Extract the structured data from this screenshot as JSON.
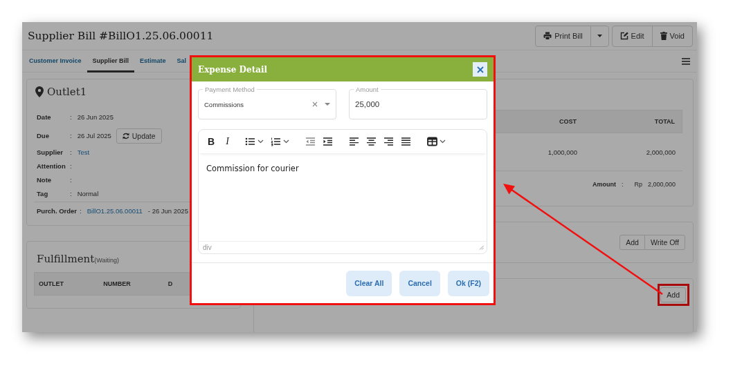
{
  "header": {
    "title": "Supplier Bill #BillO1.25.06.00011",
    "print_button": "Print Bill",
    "edit_button": "Edit",
    "void_button": "Void"
  },
  "tabs": [
    {
      "label": "Customer Invoice",
      "selected": false
    },
    {
      "label": "Supplier Bill",
      "selected": true
    },
    {
      "label": "Estimate",
      "selected": false
    },
    {
      "label": "Sal",
      "selected": false
    }
  ],
  "outlet_card": {
    "title": "Outlet1",
    "fields": [
      {
        "label": "Date",
        "colon": ":",
        "value": "26 Jun 2025"
      },
      {
        "label": "Due",
        "colon": ":",
        "value": "26 Jul 2025",
        "action": "Update"
      },
      {
        "label": "Supplier",
        "colon": ":",
        "value": "Test",
        "kind": "link"
      },
      {
        "label": "Attention",
        "colon": ":"
      },
      {
        "label": "Note",
        "colon": ":"
      },
      {
        "label": "Tag",
        "colon": ":",
        "value": "Normal"
      },
      {
        "label": "Purch. Order",
        "colon": ":",
        "value": "BillO1.25.06.00011",
        "kind": "link",
        "suffix": "- 26 Jun 2025",
        "divider": true
      }
    ]
  },
  "fulfillment": {
    "title": "Fulfillment",
    "status": "(Waiting)",
    "columns": [
      "OUTLET",
      "NUMBER",
      "D"
    ]
  },
  "items_table": {
    "columns": [
      "COST",
      "TOTAL"
    ],
    "rows": [
      [
        "1,000,000",
        "2,000,000"
      ]
    ],
    "amount_label": "Amount",
    "separator": ":",
    "currency": "Rp",
    "amount": "2,000,000"
  },
  "payments_card": {
    "buttons": [
      "Add",
      "Write Off"
    ]
  },
  "expenses_card": {
    "button": "Add",
    "highlighted": true
  },
  "callout_arrow": true,
  "dialog": {
    "title": "Expense Detail",
    "payment_method": {
      "label": "Payment Method",
      "value": "Commissions"
    },
    "amount": {
      "label": "Amount",
      "value": "25,000"
    },
    "toolbar": [
      {
        "kind": "bold",
        "label": "B"
      },
      {
        "kind": "italic",
        "label": "I"
      },
      {
        "kind": "bullet-list",
        "menu": true
      },
      {
        "kind": "numbered-list",
        "menu": true
      },
      {
        "kind": "outdent"
      },
      {
        "kind": "indent"
      },
      {
        "kind": "align-left"
      },
      {
        "kind": "align-center"
      },
      {
        "kind": "align-right"
      },
      {
        "kind": "justify"
      },
      {
        "kind": "table",
        "menu": true
      }
    ],
    "content": "Commission for courier",
    "status_path": "div",
    "buttons": [
      "Clear All",
      "Cancel",
      "Ok (F2)"
    ]
  }
}
